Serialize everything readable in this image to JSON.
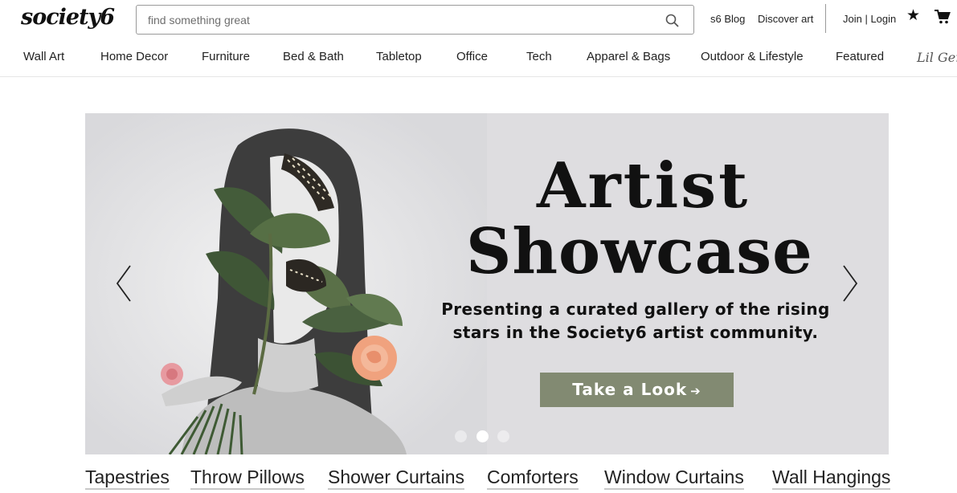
{
  "header": {
    "logo": "society6",
    "search_placeholder": "find something great",
    "links": {
      "blog": "s6 Blog",
      "discover": "Discover art",
      "login": "Join | Login"
    }
  },
  "nav": {
    "items": [
      "Wall Art",
      "Home Decor",
      "Furniture",
      "Bed & Bath",
      "Tabletop",
      "Office",
      "Tech",
      "Apparel & Bags",
      "Outdoor & Lifestyle",
      "Featured",
      "Lil Gers"
    ]
  },
  "hero": {
    "title_line1": "Artist",
    "title_line2": "Showcase",
    "subtitle_line1": "Presenting a curated gallery of the rising",
    "subtitle_line2": "stars in the Society6 artist community.",
    "cta": "Take a Look",
    "cta_arrow": "➔",
    "slides_total": 3,
    "active_slide": 2
  },
  "categories": [
    "Tapestries",
    "Throw Pillows",
    "Shower Curtains",
    "Comforters",
    "Window Curtains",
    "Wall Hangings"
  ],
  "colors": {
    "cta_bg": "#828a72",
    "hero_bg": "#dedde0",
    "text": "#222222"
  }
}
